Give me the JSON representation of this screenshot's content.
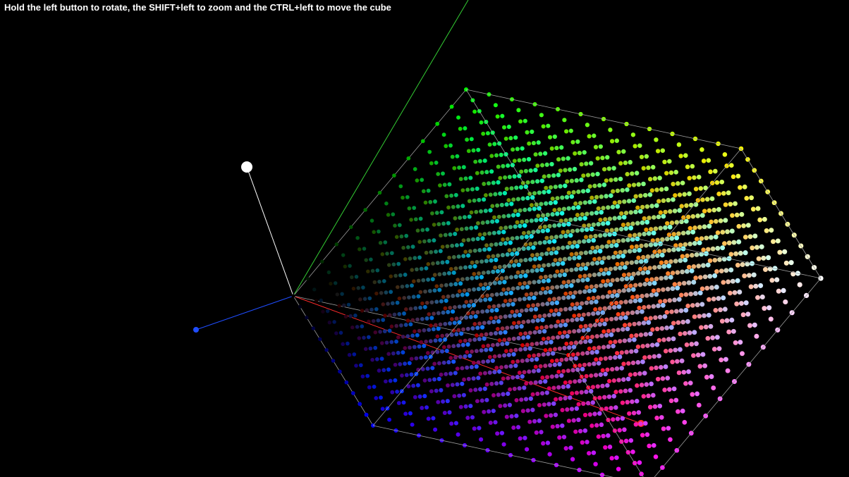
{
  "viewer": {
    "instructions": "Hold the left button to rotate, the SHIFT+left to zoom and the CTRL+left to move the cube",
    "background_color": "#000000"
  },
  "scene": {
    "object": "rgb-color-cube",
    "grid_resolution": 12,
    "edge_color": "#9a9a9a",
    "axes": [
      {
        "name": "red-axis",
        "color": "#ff2a2a"
      },
      {
        "name": "green-axis",
        "color": "#33cc33"
      },
      {
        "name": "blue-axis",
        "color": "#1f4dff"
      },
      {
        "name": "white-axis",
        "color": "#ffffff"
      }
    ]
  }
}
